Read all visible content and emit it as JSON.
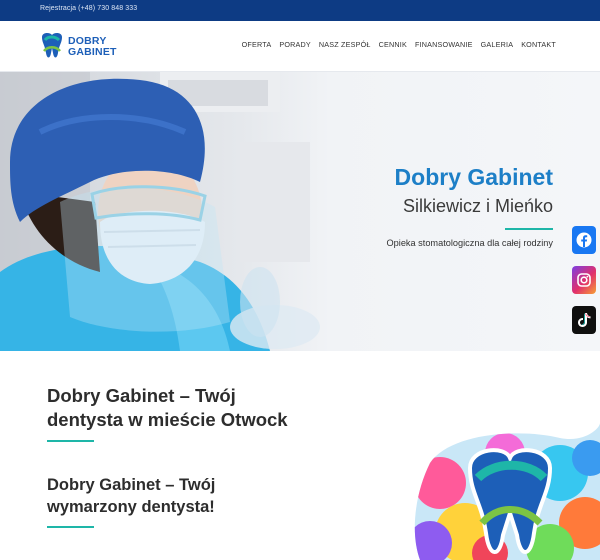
{
  "topbar": {
    "phone": "Rejestracja (+48) 730 848 333"
  },
  "logo": {
    "line1": "DOBRY",
    "line2": "GABINET"
  },
  "nav": {
    "items": [
      "OFERTA",
      "PORADY",
      "NASZ ZESPÓŁ",
      "CENNIK",
      "FINANSOWANIE",
      "GALERIA",
      "KONTAKT"
    ]
  },
  "hero": {
    "title": "Dobry Gabinet",
    "subtitle": "Silkiewicz i Mieńko",
    "tagline": "Opieka stomatologiczna dla całej rodziny"
  },
  "social": {
    "icons": [
      "facebook-icon",
      "instagram-icon",
      "tiktok-icon"
    ]
  },
  "content": {
    "heading1": "Dobry Gabinet – Twój dentysta w mieście Otwock",
    "heading2": "Dobry Gabinet – Twój wymarzony dentysta!"
  },
  "colors": {
    "topbar": "#0d3b84",
    "brand_blue": "#1d7fc7",
    "accent": "#1eb6a8"
  }
}
